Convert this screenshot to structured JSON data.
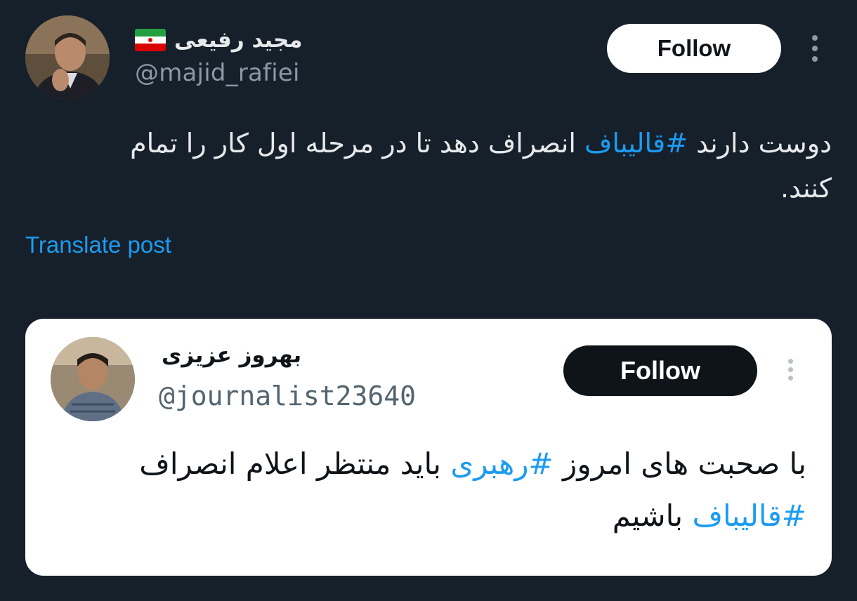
{
  "post": {
    "author_name": "مجید رفیعی",
    "author_handle": "@majid_rafiei",
    "flag_icon": "iran-flag-icon",
    "follow_label": "Follow",
    "more_icon": "more-vertical-icon",
    "text_before": "دوست دارند ",
    "hashtag": "#قالیباف",
    "text_after": " انصراف دهد تا در مرحله اول کار را تمام کنند.",
    "translate_label": "Translate post"
  },
  "quote": {
    "author_name": "بهروز عزیزی",
    "author_handle": "@journalist23640",
    "follow_label": "Follow",
    "more_icon": "more-vertical-icon",
    "text_part1": "با صحبت های امروز ",
    "hashtag1": "#رهبری",
    "text_part2": " باید منتظر اعلام انصراف ",
    "hashtag2": "#قالیباف",
    "text_part3": " باشیم"
  },
  "colors": {
    "background": "#15202b",
    "link": "#1d9bf0",
    "primary_text": "#e7e9ea",
    "secondary_text": "#8b98a5"
  }
}
